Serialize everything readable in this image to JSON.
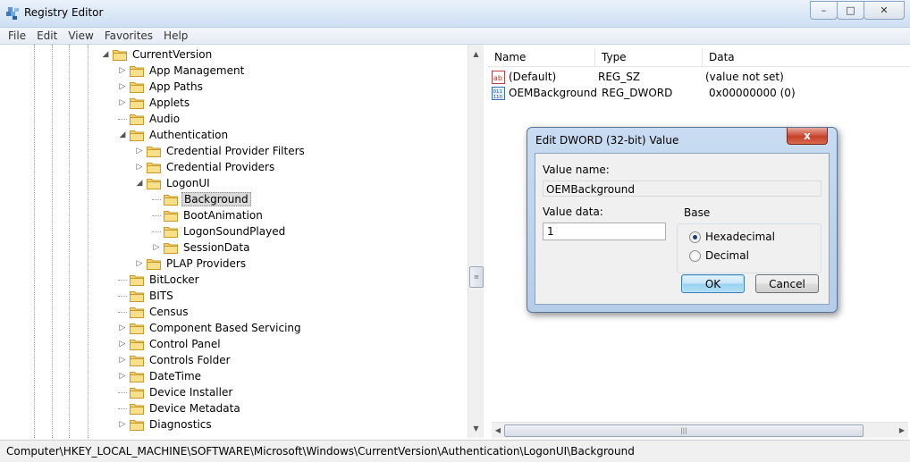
{
  "window": {
    "title": "Registry Editor"
  },
  "menu": [
    "File",
    "Edit",
    "View",
    "Favorites",
    "Help"
  ],
  "tree": [
    {
      "label": "CurrentVersion",
      "level": 0,
      "expander": "open"
    },
    {
      "label": "App Management",
      "level": 1,
      "expander": "closed"
    },
    {
      "label": "App Paths",
      "level": 1,
      "expander": "closed"
    },
    {
      "label": "Applets",
      "level": 1,
      "expander": "closed"
    },
    {
      "label": "Audio",
      "level": 1,
      "expander": "none"
    },
    {
      "label": "Authentication",
      "level": 1,
      "expander": "open"
    },
    {
      "label": "Credential Provider Filters",
      "level": 2,
      "expander": "closed"
    },
    {
      "label": "Credential Providers",
      "level": 2,
      "expander": "closed"
    },
    {
      "label": "LogonUI",
      "level": 2,
      "expander": "open"
    },
    {
      "label": "Background",
      "level": 3,
      "expander": "none",
      "selected": true
    },
    {
      "label": "BootAnimation",
      "level": 3,
      "expander": "none"
    },
    {
      "label": "LogonSoundPlayed",
      "level": 3,
      "expander": "none"
    },
    {
      "label": "SessionData",
      "level": 3,
      "expander": "closed"
    },
    {
      "label": "PLAP Providers",
      "level": 2,
      "expander": "closed"
    },
    {
      "label": "BitLocker",
      "level": 1,
      "expander": "none"
    },
    {
      "label": "BITS",
      "level": 1,
      "expander": "none"
    },
    {
      "label": "Census",
      "level": 1,
      "expander": "none"
    },
    {
      "label": "Component Based Servicing",
      "level": 1,
      "expander": "closed"
    },
    {
      "label": "Control Panel",
      "level": 1,
      "expander": "closed"
    },
    {
      "label": "Controls Folder",
      "level": 1,
      "expander": "closed"
    },
    {
      "label": "DateTime",
      "level": 1,
      "expander": "closed"
    },
    {
      "label": "Device Installer",
      "level": 1,
      "expander": "none"
    },
    {
      "label": "Device Metadata",
      "level": 1,
      "expander": "none"
    },
    {
      "label": "Diagnostics",
      "level": 1,
      "expander": "closed"
    }
  ],
  "list": {
    "headers": {
      "name": "Name",
      "type": "Type",
      "data": "Data"
    },
    "rows": [
      {
        "name": "(Default)",
        "type": "REG_SZ",
        "data": "(value not set)",
        "icon": "string-value-icon"
      },
      {
        "name": "OEMBackground",
        "type": "REG_DWORD",
        "data": "0x00000000 (0)",
        "icon": "binary-value-icon"
      }
    ]
  },
  "status": {
    "path": "Computer\\HKEY_LOCAL_MACHINE\\SOFTWARE\\Microsoft\\Windows\\CurrentVersion\\Authentication\\LogonUI\\Background"
  },
  "dialog": {
    "title": "Edit DWORD (32-bit) Value",
    "close_label": "x",
    "value_name_label": "Value name:",
    "value_name": "OEMBackground",
    "value_data_label": "Value data:",
    "value_data": "1",
    "base_label": "Base",
    "hex_label": "Hexadecimal",
    "dec_label": "Decimal",
    "ok_label": "OK",
    "cancel_label": "Cancel"
  },
  "colors": {
    "titlebar": "#dbe8f6",
    "selection": "#d9d9d9",
    "dialog_frame": "#b5cde9",
    "close_red": "#c7412b"
  }
}
